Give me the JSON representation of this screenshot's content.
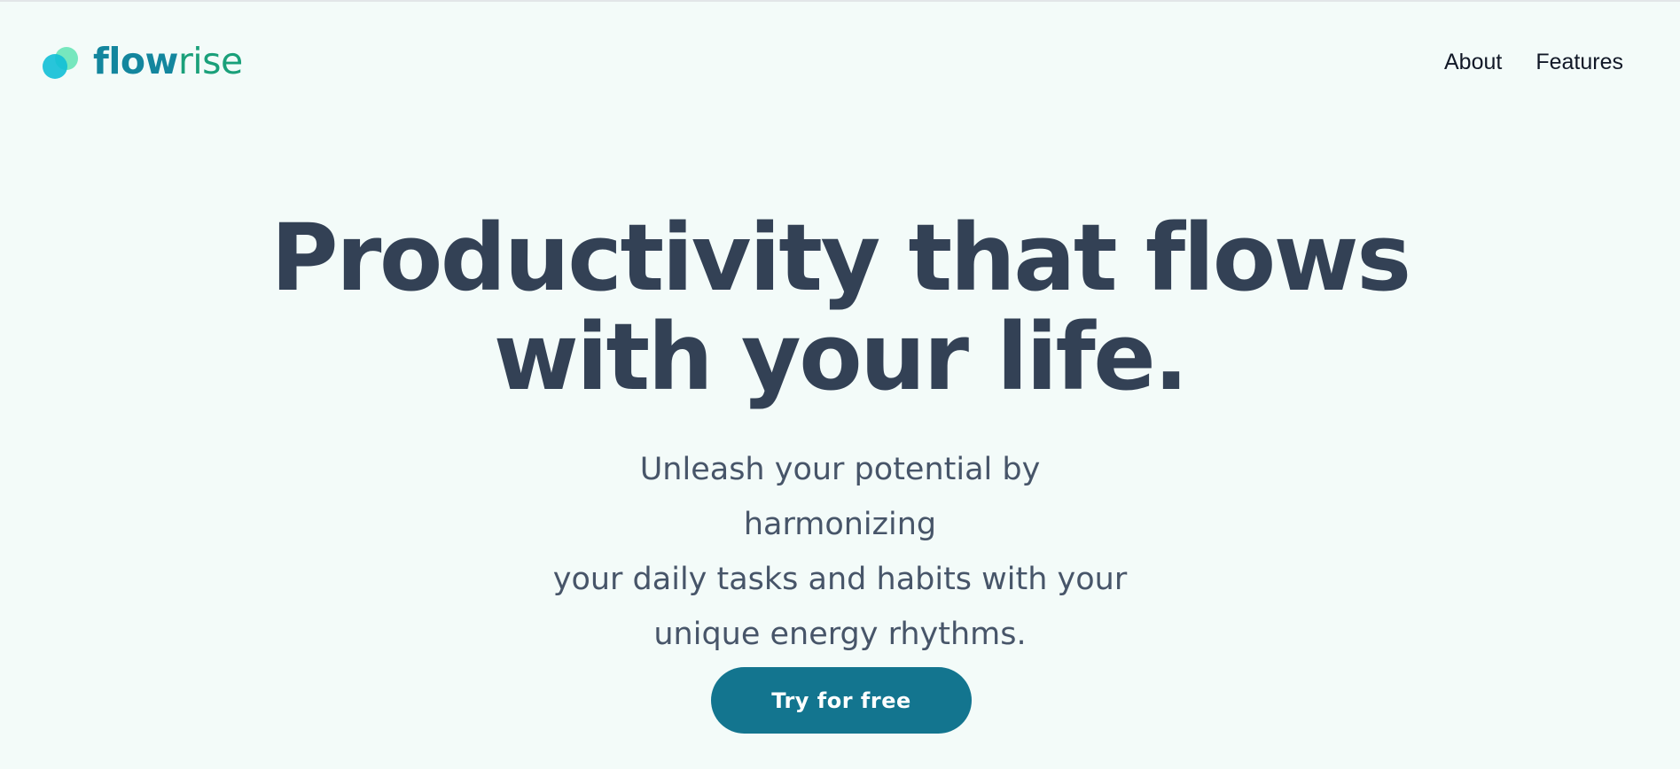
{
  "brand": {
    "name_part1": "flow",
    "name_part2": "rise",
    "logo_icon": "overlapping-circles-logo"
  },
  "nav": {
    "items": [
      {
        "label": "About"
      },
      {
        "label": "Features"
      }
    ]
  },
  "hero": {
    "headline_line1": "Productivity that flows",
    "headline_line2": "with your life.",
    "subhead_line1": "Unleash your potential by harmonizing",
    "subhead_line2": "your daily tasks and habits with your",
    "subhead_line3": "unique energy rhythms.",
    "cta_label": "Try for free"
  },
  "colors": {
    "background": "#f3fbf9",
    "brand_primary": "#13869e",
    "brand_secondary": "#1aa07a",
    "headline": "#334155",
    "subhead": "#475569",
    "cta": "#13758f"
  }
}
